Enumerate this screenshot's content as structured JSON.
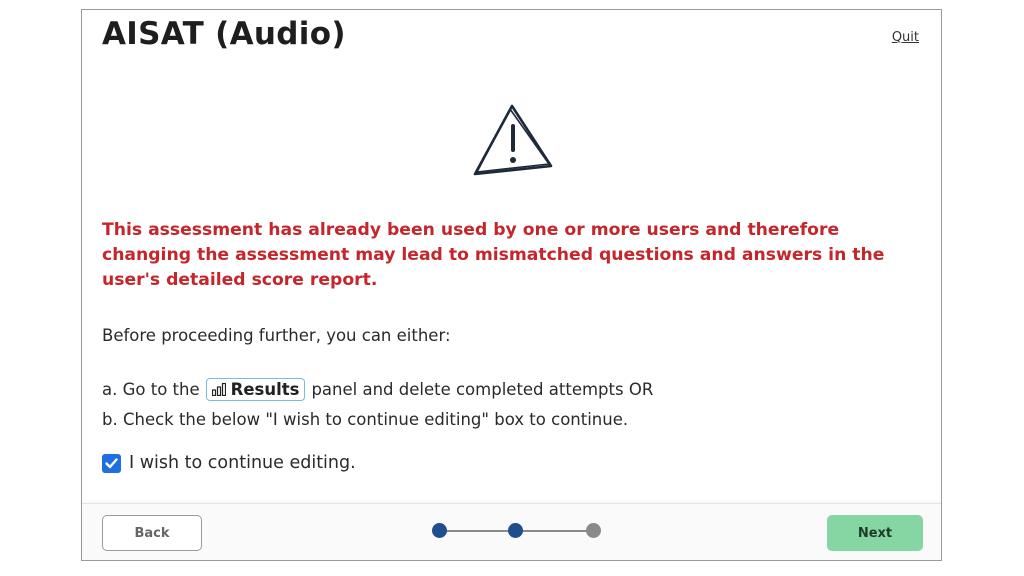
{
  "header": {
    "title": "AISAT (Audio)",
    "quit_label": "Quit"
  },
  "warning": {
    "icon": "warning-triangle-icon",
    "text": "This assessment has already been used by one or more users and therefore changing the assessment may lead to mismatched questions and answers in the user's detailed score report.",
    "color": "#c4262b"
  },
  "instructions": {
    "intro": "Before proceeding further, you can either:",
    "option_a_prefix": "a. Go to the",
    "results_label": "Results",
    "results_icon": "bar-chart-icon",
    "option_a_suffix": "panel and delete completed attempts OR",
    "option_b": "b. Check the below \"I wish to continue editing\" box to continue."
  },
  "checkbox": {
    "label": "I wish to continue editing.",
    "checked": true,
    "color": "#1e6fe0"
  },
  "footer": {
    "back_label": "Back",
    "next_label": "Next",
    "next_color": "#86d6a3",
    "steps": [
      {
        "state": "complete",
        "color": "#1f4e8c"
      },
      {
        "state": "current",
        "color": "#1f4e8c"
      },
      {
        "state": "upcoming",
        "color": "#8a8a8a"
      }
    ]
  }
}
